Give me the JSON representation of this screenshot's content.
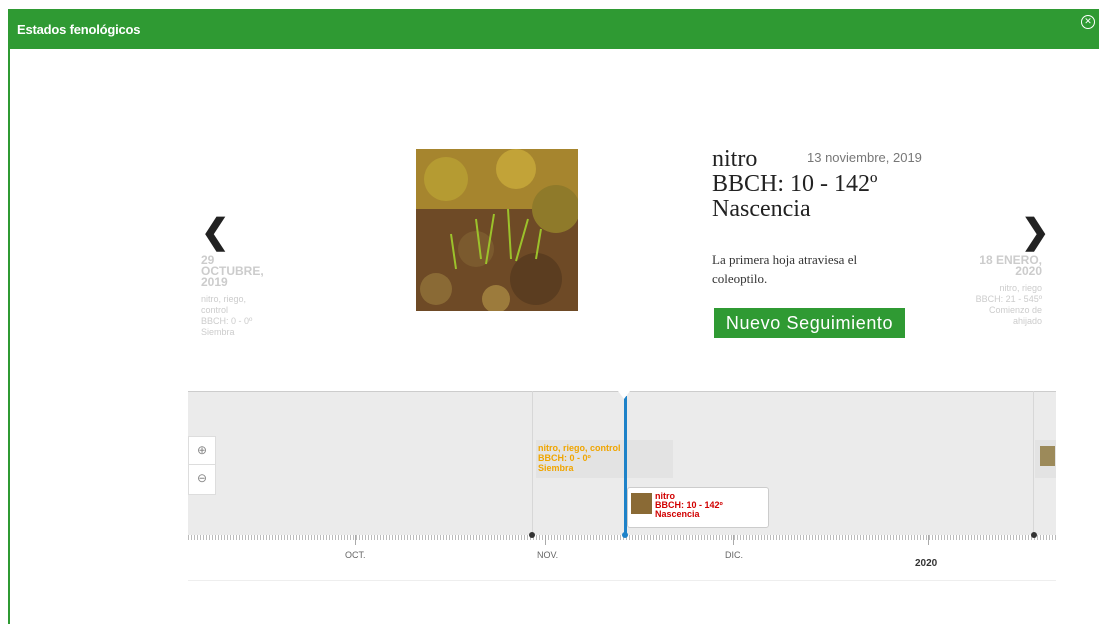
{
  "window": {
    "title": "Estados fenológicos",
    "close_icon": "close-circle-icon"
  },
  "slide": {
    "title_lines": [
      "nitro",
      "BBCH: 10 - 142º",
      "Nascencia"
    ],
    "date": "13 noviembre, 2019",
    "description": "La primera hoja atraviesa el coleoptilo.",
    "button_label": "Nuevo Seguimiento",
    "image_alt": "seedlings emerging from soil"
  },
  "prev": {
    "arrow_icon": "chevron-left-icon",
    "date_lines": [
      "29",
      "OCTUBRE,",
      "2019"
    ],
    "meta_lines": [
      "nitro, riego,",
      "control",
      "BBCH: 0 - 0º",
      "Siembra"
    ]
  },
  "next": {
    "arrow_icon": "chevron-right-icon",
    "date_lines": [
      "18 ENERO,",
      "2020"
    ],
    "meta_lines": [
      "nitro, riego",
      "BBCH: 21 - 545º",
      "Comienzo de",
      "ahijado"
    ]
  },
  "timeline": {
    "zoom_in_icon": "zoom-in-icon",
    "zoom_out_icon": "zoom-out-icon",
    "events": [
      {
        "lines": [
          "nitro, riego, control",
          "BBCH: 0 - 0º",
          "Siembra"
        ],
        "color": "#f0a500"
      },
      {
        "lines": [
          "nitro",
          "BBCH: 10 - 142º",
          "Nascencia"
        ],
        "color": "#d10000"
      }
    ],
    "months": [
      "OCT.",
      "NOV.",
      "DIC."
    ],
    "year": "2020",
    "marker_color": "#1e82c8"
  },
  "colors": {
    "accent": "#2f9a33"
  }
}
